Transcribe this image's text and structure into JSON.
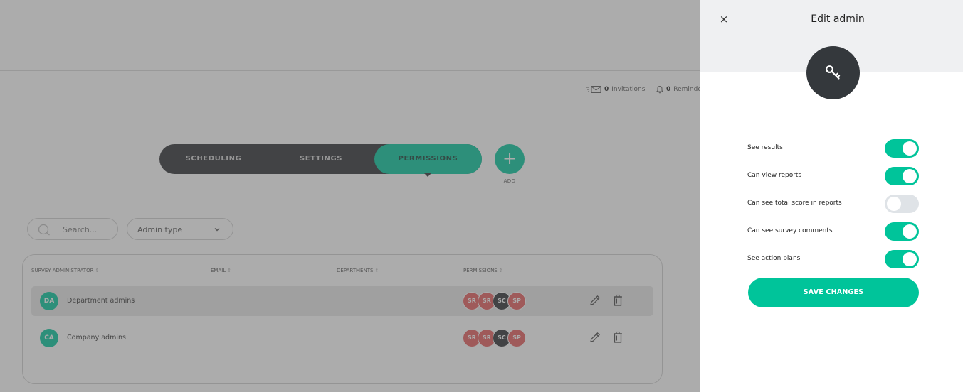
{
  "colors": {
    "accent": "#00c49a",
    "dark": "#2b2d30",
    "badge_red": "#e45a5a",
    "overlay": "rgba(90,90,90,0.5)"
  },
  "subbar": {
    "invitations": {
      "icon": "mail-list-icon",
      "count": "0",
      "label": "Invitations"
    },
    "reminders": {
      "icon": "bell-icon",
      "count": "0",
      "label": "Reminde"
    }
  },
  "tabs": [
    {
      "label": "SCHEDULING",
      "active": false
    },
    {
      "label": "SETTINGS",
      "active": false
    },
    {
      "label": "PERMISSIONS",
      "active": true
    }
  ],
  "add_button": {
    "icon": "plus-icon",
    "label": "ADD"
  },
  "filters": {
    "search_placeholder": "Search...",
    "admin_type": "Admin type"
  },
  "table": {
    "headers": [
      "SURVEY ADMINISTRATOR",
      "EMAIL",
      "DEPARTMENTS",
      "PERMISSIONS"
    ],
    "rows": [
      {
        "initials": "DA",
        "name": "Department admins",
        "highlighted": true,
        "permissions": [
          "SR",
          "SR",
          "SC",
          "SP"
        ]
      },
      {
        "initials": "CA",
        "name": "Company admins",
        "highlighted": false,
        "permissions": [
          "SR",
          "SR",
          "SC",
          "SP"
        ]
      }
    ]
  },
  "panel": {
    "close": "×",
    "title": "Edit admin",
    "icon": "key-icon",
    "permissions": [
      {
        "label": "See results",
        "enabled": true
      },
      {
        "label": "Can view reports",
        "enabled": true
      },
      {
        "label": "Can see total score in reports",
        "enabled": false
      },
      {
        "label": "Can see survey comments",
        "enabled": true
      },
      {
        "label": "See action plans",
        "enabled": true
      }
    ],
    "save_label": "SAVE CHANGES"
  }
}
